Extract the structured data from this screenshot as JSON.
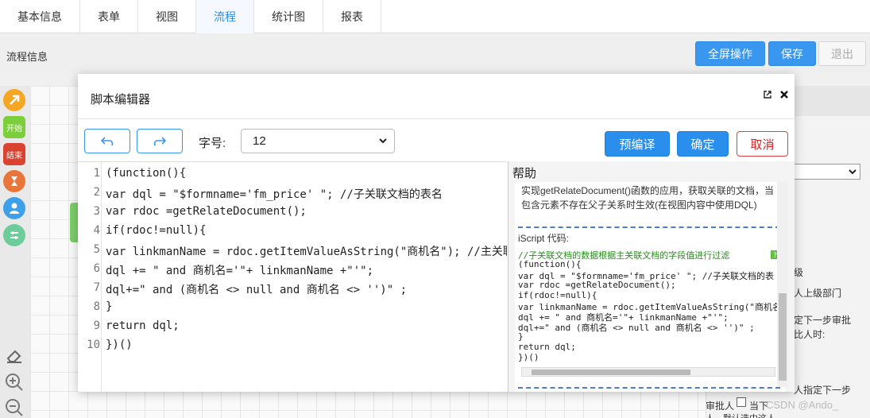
{
  "tabs": [
    {
      "label": "基本信息"
    },
    {
      "label": "表单"
    },
    {
      "label": "视图"
    },
    {
      "label": "流程",
      "active": true
    },
    {
      "label": "统计图"
    },
    {
      "label": "报表"
    }
  ],
  "toolbar": {
    "section_label": "流程信息",
    "fullscreen_label": "全屏操作",
    "save_label": "保存",
    "exit_label": "退出"
  },
  "tools": [
    {
      "name": "arrow-tool",
      "icon": "arrow-icon",
      "color": "#f5a623"
    },
    {
      "name": "start-node-tool",
      "label": "开始",
      "color": "#7ccf3a"
    },
    {
      "name": "end-node-tool",
      "label": "结束",
      "color": "#d9432f"
    },
    {
      "name": "wait-node-tool",
      "icon": "hourglass-icon",
      "color": "#e8763a"
    },
    {
      "name": "user-node-tool",
      "icon": "user-icon",
      "color": "#3da0e8"
    },
    {
      "name": "split-node-tool",
      "icon": "split-icon",
      "color": "#6ccd9a"
    }
  ],
  "editor_modal": {
    "title": "脚本编辑器",
    "font_size_label": "字号:",
    "font_size_value": "12",
    "precompile_label": "预编译",
    "confirm_label": "确定",
    "cancel_label": "取消",
    "code_lines": [
      "(function(){",
      "var dql = \"$formname='fm_price' \"; //子关联文档的表名",
      "var rdoc =getRelateDocument();",
      "if(rdoc!=null){",
      "var linkmanName = rdoc.getItemValueAsString(\"商机名\"); //主关联",
      "dql += \" and 商机名='\"+ linkmanName +\"'\";",
      "dql+=\" and (商机名 <> null and 商机名 <> '')\" ;",
      "}",
      "return dql;",
      "})()"
    ]
  },
  "help": {
    "title": "帮助",
    "description": "实现getRelateDocument()函数的应用，获取关联的文档，当包含元素不存在父子关系时生效(在视图内容中使用DQL)",
    "subtitle": "iScript 代码:",
    "code_lines": [
      "//子关联文档的数据根据主关联文档的字段值进行过滤",
      "(function(){",
      "var dql = \"$formname='fm_price' \"; //子关联文档的表",
      "var rdoc =getRelateDocument();",
      "if(rdoc!=null){",
      "var linkmanName = rdoc.getItemValueAsString(\"商机名",
      "dql += \" and 商机名='\"+ linkmanName +\"'\";",
      "dql+=\" and (商机名 <> null and 商机名 <> '')\" ;",
      "}",
      "return dql;",
      "})()"
    ]
  },
  "right_panel": {
    "text_level": "级",
    "text_parent_dept": "人上级部门",
    "text_next_step": "定下一步审批",
    "text_approver": "比人时:",
    "text_assign_next": "人指定下一步",
    "text_approver_footer": "审批人",
    "text_current": "当下",
    "text_default": "人，默认选中这人"
  },
  "watermark": "CSDN @Ando_"
}
